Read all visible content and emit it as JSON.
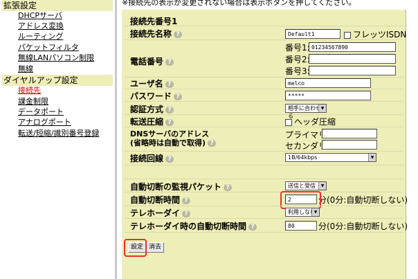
{
  "top_note": "※接続先の表示が変更されない場合は表示ボタンを押してください。",
  "sidebar": {
    "section_extended": "拡張設定",
    "extended_items": [
      "DHCPサーバ",
      "アドレス変換",
      "ルーティング",
      "パケットフィルタ",
      "無線LANパソコン制限",
      "無線"
    ],
    "section_dialup": "ダイヤルアップ設定",
    "dialup_items": [
      "接続先",
      "課金制限",
      "データポート",
      "アナログポート",
      "転送/短縮/識別番号登録"
    ],
    "current_item": "接続先"
  },
  "form": {
    "connection_number": "接続先番号1",
    "name_label": "接続先名称",
    "name_value": "Default1",
    "flets_label": "フレッツISDN",
    "phone_label": "電話番号",
    "phone1_label": "番号1:",
    "phone1_value": "01234567890",
    "phone2_label": "番号2:",
    "phone2_value": "",
    "phone3_label": "番号3:",
    "phone3_value": "",
    "user_label": "ユーザ名",
    "user_value": "melco",
    "password_label": "パスワード",
    "password_value": "*****",
    "auth_label": "認証方式",
    "auth_value": "相手に合わせる",
    "compress_label": "転送圧縮",
    "header_compress_label": "ヘッダ圧縮",
    "dns_label_1": "DNSサーバのアドレス",
    "dns_label_2": "(省略時は自動で取得)",
    "dns_primary_label": "プライマリ",
    "dns_primary_value": "",
    "dns_secondary_label": "セカンダリ",
    "dns_secondary_value": "",
    "line_label": "接続回線",
    "line_value": "1B/64kbps",
    "monitor_label": "自動切断の監視パケット",
    "monitor_value": "送信と受信",
    "auto_disconnect_label": "自動切断時間",
    "auto_disconnect_value": "2",
    "auto_disconnect_unit": "分(0分:自動切断しない)",
    "telehodai_label": "テレホーダイ",
    "telehodai_value": "利用しない",
    "telehodai_auto_label": "テレホーダイ時の自動切断時間",
    "telehodai_auto_value": "80",
    "telehodai_auto_unit": "分(0分:自動切断しない)"
  },
  "buttons": {
    "save": "設定",
    "delete": "消去"
  },
  "help_icon": "?"
}
